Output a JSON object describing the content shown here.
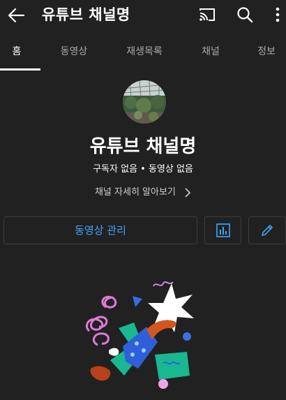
{
  "header": {
    "title": "유튜브 채널명",
    "icons": [
      "back-arrow-icon",
      "cast-icon",
      "search-icon",
      "more-vert-icon"
    ]
  },
  "tabs": [
    {
      "label": "홈",
      "active": true
    },
    {
      "label": "동영상",
      "active": false
    },
    {
      "label": "재생목록",
      "active": false
    },
    {
      "label": "채널",
      "active": false
    },
    {
      "label": "정보",
      "active": false
    }
  ],
  "channel": {
    "name": "유튜브 채널명",
    "meta": "구독자 없음 • 동영상 없음",
    "about_link": "채널 자세히 알아보기"
  },
  "actions": {
    "manage_videos": "동영상 관리",
    "analytics_icon": "bar-chart-icon",
    "edit_icon": "pencil-icon"
  },
  "colors": {
    "background": "#212121",
    "accent": "#3ea6ff",
    "tab_inactive": "#aaaaaa"
  }
}
